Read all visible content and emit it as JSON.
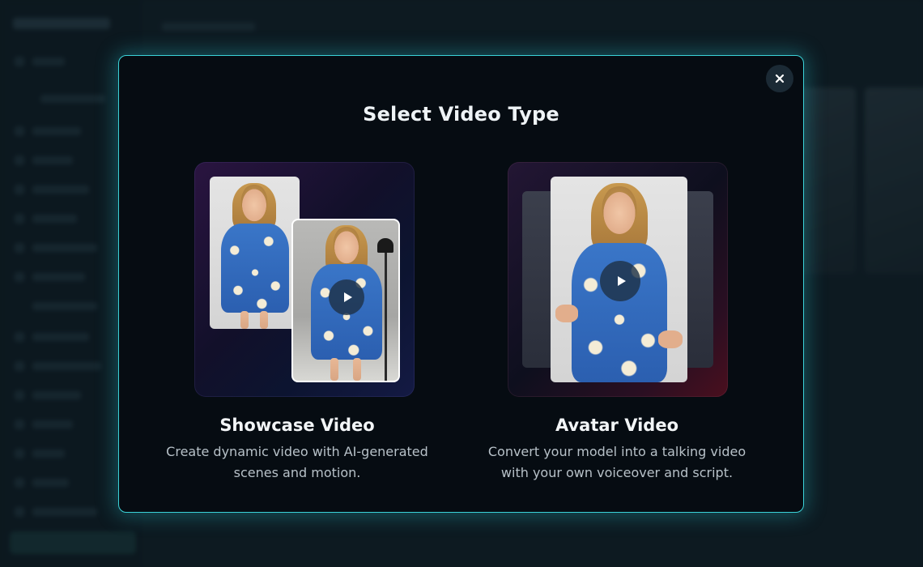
{
  "modal": {
    "title": "Select Video Type",
    "close_icon": "close-icon"
  },
  "options": [
    {
      "title": "Showcase Video",
      "description": "Create dynamic video with AI-generated scenes and motion.",
      "icon": "play-icon"
    },
    {
      "title": "Avatar Video",
      "description": "Convert your model into a talking video with your own voiceover and script.",
      "icon": "play-icon"
    }
  ],
  "colors": {
    "accent": "#3bd2d8",
    "modal_bg": "#060c12",
    "page_bg": "#0f1d24"
  }
}
